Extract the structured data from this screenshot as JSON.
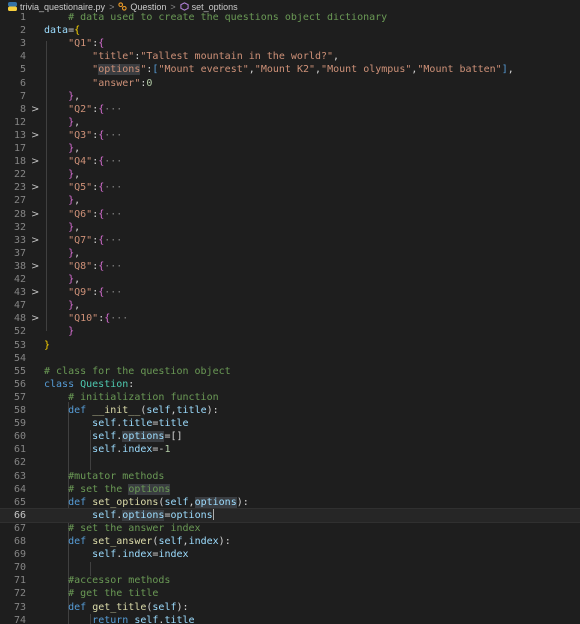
{
  "breadcrumb": {
    "file": "trivia_questionaire.py",
    "class": "Question",
    "method": "set_options"
  },
  "lines": [
    {
      "n": "1",
      "fold": "",
      "tokens": [
        [
          "    ",
          "t-op"
        ],
        [
          "# data used to create the questions object dictionary",
          "t-com"
        ]
      ]
    },
    {
      "n": "2",
      "fold": "",
      "tokens": [
        [
          "data",
          "t-var"
        ],
        [
          "=",
          "t-op"
        ],
        [
          "{",
          "t-brk"
        ]
      ]
    },
    {
      "n": "3",
      "fold": "",
      "tokens": [
        [
          "    ",
          "t-op"
        ],
        [
          "\"Q1\"",
          "t-str"
        ],
        [
          ":",
          "t-op"
        ],
        [
          "{",
          "t-brk2"
        ]
      ]
    },
    {
      "n": "4",
      "fold": "",
      "tokens": [
        [
          "        ",
          "t-op"
        ],
        [
          "\"title\"",
          "t-str"
        ],
        [
          ":",
          "t-op"
        ],
        [
          "\"Tallest mountain in the world?\"",
          "t-str"
        ],
        [
          ",",
          "t-op"
        ]
      ]
    },
    {
      "n": "5",
      "fold": "",
      "tokens": [
        [
          "        ",
          "t-op"
        ],
        [
          "\"",
          "t-str"
        ],
        [
          "options",
          "t-str hl"
        ],
        [
          "\"",
          "t-str"
        ],
        [
          ":",
          "t-op"
        ],
        [
          "[",
          "t-kw"
        ],
        [
          "\"Mount everest\"",
          "t-str"
        ],
        [
          ",",
          "t-op"
        ],
        [
          "\"Mount K2\"",
          "t-str"
        ],
        [
          ",",
          "t-op"
        ],
        [
          "\"Mount olympus\"",
          "t-str"
        ],
        [
          ",",
          "t-op"
        ],
        [
          "\"Mount batten\"",
          "t-str"
        ],
        [
          "]",
          "t-kw"
        ],
        [
          ",",
          "t-op"
        ]
      ]
    },
    {
      "n": "6",
      "fold": "",
      "tokens": [
        [
          "        ",
          "t-op"
        ],
        [
          "\"answer\"",
          "t-str"
        ],
        [
          ":",
          "t-op"
        ],
        [
          "0",
          "t-num"
        ]
      ]
    },
    {
      "n": "7",
      "fold": "",
      "tokens": [
        [
          "    ",
          "t-op"
        ],
        [
          "}",
          "t-brk2"
        ],
        [
          ",",
          "t-op"
        ]
      ]
    },
    {
      "n": "8",
      "fold": ">",
      "tokens": [
        [
          "    ",
          "t-op"
        ],
        [
          "\"Q2\"",
          "t-str"
        ],
        [
          ":",
          "t-op"
        ],
        [
          "{",
          "t-brk2"
        ],
        [
          "···",
          "t-ell"
        ]
      ]
    },
    {
      "n": "12",
      "fold": "",
      "tokens": [
        [
          "    ",
          "t-op"
        ],
        [
          "}",
          "t-brk2"
        ],
        [
          ",",
          "t-op"
        ]
      ]
    },
    {
      "n": "13",
      "fold": ">",
      "tokens": [
        [
          "    ",
          "t-op"
        ],
        [
          "\"Q3\"",
          "t-str"
        ],
        [
          ":",
          "t-op"
        ],
        [
          "{",
          "t-brk2"
        ],
        [
          "···",
          "t-ell"
        ]
      ]
    },
    {
      "n": "17",
      "fold": "",
      "tokens": [
        [
          "    ",
          "t-op"
        ],
        [
          "}",
          "t-brk2"
        ],
        [
          ",",
          "t-op"
        ]
      ]
    },
    {
      "n": "18",
      "fold": ">",
      "tokens": [
        [
          "    ",
          "t-op"
        ],
        [
          "\"Q4\"",
          "t-str"
        ],
        [
          ":",
          "t-op"
        ],
        [
          "{",
          "t-brk2"
        ],
        [
          "···",
          "t-ell"
        ]
      ]
    },
    {
      "n": "22",
      "fold": "",
      "tokens": [
        [
          "    ",
          "t-op"
        ],
        [
          "}",
          "t-brk2"
        ],
        [
          ",",
          "t-op"
        ]
      ]
    },
    {
      "n": "23",
      "fold": ">",
      "tokens": [
        [
          "    ",
          "t-op"
        ],
        [
          "\"Q5\"",
          "t-str"
        ],
        [
          ":",
          "t-op"
        ],
        [
          "{",
          "t-brk2"
        ],
        [
          "···",
          "t-ell"
        ]
      ]
    },
    {
      "n": "27",
      "fold": "",
      "tokens": [
        [
          "    ",
          "t-op"
        ],
        [
          "}",
          "t-brk2"
        ],
        [
          ",",
          "t-op"
        ]
      ]
    },
    {
      "n": "28",
      "fold": ">",
      "tokens": [
        [
          "    ",
          "t-op"
        ],
        [
          "\"Q6\"",
          "t-str"
        ],
        [
          ":",
          "t-op"
        ],
        [
          "{",
          "t-brk2"
        ],
        [
          "···",
          "t-ell"
        ]
      ]
    },
    {
      "n": "32",
      "fold": "",
      "tokens": [
        [
          "    ",
          "t-op"
        ],
        [
          "}",
          "t-brk2"
        ],
        [
          ",",
          "t-op"
        ]
      ]
    },
    {
      "n": "33",
      "fold": ">",
      "tokens": [
        [
          "    ",
          "t-op"
        ],
        [
          "\"Q7\"",
          "t-str"
        ],
        [
          ":",
          "t-op"
        ],
        [
          "{",
          "t-brk2"
        ],
        [
          "···",
          "t-ell"
        ]
      ]
    },
    {
      "n": "37",
      "fold": "",
      "tokens": [
        [
          "    ",
          "t-op"
        ],
        [
          "}",
          "t-brk2"
        ],
        [
          ",",
          "t-op"
        ]
      ]
    },
    {
      "n": "38",
      "fold": ">",
      "tokens": [
        [
          "    ",
          "t-op"
        ],
        [
          "\"Q8\"",
          "t-str"
        ],
        [
          ":",
          "t-op"
        ],
        [
          "{",
          "t-brk2"
        ],
        [
          "···",
          "t-ell"
        ]
      ]
    },
    {
      "n": "42",
      "fold": "",
      "tokens": [
        [
          "    ",
          "t-op"
        ],
        [
          "}",
          "t-brk2"
        ],
        [
          ",",
          "t-op"
        ]
      ]
    },
    {
      "n": "43",
      "fold": ">",
      "tokens": [
        [
          "    ",
          "t-op"
        ],
        [
          "\"Q9\"",
          "t-str"
        ],
        [
          ":",
          "t-op"
        ],
        [
          "{",
          "t-brk2"
        ],
        [
          "···",
          "t-ell"
        ]
      ]
    },
    {
      "n": "47",
      "fold": "",
      "tokens": [
        [
          "    ",
          "t-op"
        ],
        [
          "}",
          "t-brk2"
        ],
        [
          ",",
          "t-op"
        ]
      ]
    },
    {
      "n": "48",
      "fold": ">",
      "tokens": [
        [
          "    ",
          "t-op"
        ],
        [
          "\"Q10\"",
          "t-str"
        ],
        [
          ":",
          "t-op"
        ],
        [
          "{",
          "t-brk2"
        ],
        [
          "···",
          "t-ell"
        ]
      ]
    },
    {
      "n": "52",
      "fold": "",
      "tokens": [
        [
          "    ",
          "t-op"
        ],
        [
          "}",
          "t-brk2"
        ]
      ]
    },
    {
      "n": "53",
      "fold": "",
      "tokens": [
        [
          "}",
          "t-brk"
        ]
      ]
    },
    {
      "n": "54",
      "fold": "",
      "tokens": []
    },
    {
      "n": "55",
      "fold": "",
      "tokens": [
        [
          "# class for the question object",
          "t-com"
        ]
      ]
    },
    {
      "n": "56",
      "fold": "",
      "tokens": [
        [
          "class ",
          "t-kw"
        ],
        [
          "Question",
          "t-cls"
        ],
        [
          ":",
          "t-op"
        ]
      ]
    },
    {
      "n": "57",
      "fold": "",
      "tokens": [
        [
          "    ",
          "t-op"
        ],
        [
          "# initialization function",
          "t-com"
        ]
      ]
    },
    {
      "n": "58",
      "fold": "",
      "tokens": [
        [
          "    ",
          "t-op"
        ],
        [
          "def ",
          "t-kw"
        ],
        [
          "__init__",
          "t-fn"
        ],
        [
          "(",
          "t-op"
        ],
        [
          "self",
          "t-self"
        ],
        [
          ",",
          "t-op"
        ],
        [
          "title",
          "t-self"
        ],
        [
          "):",
          "t-op"
        ]
      ]
    },
    {
      "n": "59",
      "fold": "",
      "tokens": [
        [
          "        ",
          "t-op"
        ],
        [
          "self",
          "t-self"
        ],
        [
          ".",
          "t-op"
        ],
        [
          "title",
          "t-self"
        ],
        [
          "=",
          "t-op"
        ],
        [
          "title",
          "t-self"
        ]
      ]
    },
    {
      "n": "60",
      "fold": "",
      "tokens": [
        [
          "        ",
          "t-op"
        ],
        [
          "self",
          "t-self"
        ],
        [
          ".",
          "t-op"
        ],
        [
          "options",
          "t-self hl"
        ],
        [
          "=[]",
          "t-op"
        ]
      ]
    },
    {
      "n": "61",
      "fold": "",
      "tokens": [
        [
          "        ",
          "t-op"
        ],
        [
          "self",
          "t-self"
        ],
        [
          ".",
          "t-op"
        ],
        [
          "index",
          "t-self"
        ],
        [
          "=-",
          "t-op"
        ],
        [
          "1",
          "t-num"
        ]
      ]
    },
    {
      "n": "62",
      "fold": "",
      "tokens": []
    },
    {
      "n": "63",
      "fold": "",
      "tokens": [
        [
          "    ",
          "t-op"
        ],
        [
          "#mutator methods",
          "t-com"
        ]
      ]
    },
    {
      "n": "64",
      "fold": "",
      "tokens": [
        [
          "    ",
          "t-op"
        ],
        [
          "# set the ",
          "t-com"
        ],
        [
          "options",
          "t-com hl"
        ]
      ]
    },
    {
      "n": "65",
      "fold": "",
      "tokens": [
        [
          "    ",
          "t-op"
        ],
        [
          "def ",
          "t-kw"
        ],
        [
          "set_options",
          "t-fn"
        ],
        [
          "(",
          "t-op"
        ],
        [
          "self",
          "t-self"
        ],
        [
          ",",
          "t-op"
        ],
        [
          "options",
          "t-self hl"
        ],
        [
          "):",
          "t-op"
        ]
      ]
    },
    {
      "n": "66",
      "fold": "",
      "current": true,
      "tokens": [
        [
          "        ",
          "t-op"
        ],
        [
          "self",
          "t-self"
        ],
        [
          ".",
          "t-op"
        ],
        [
          "options",
          "t-self hl"
        ],
        [
          "=",
          "t-op"
        ],
        [
          "options",
          "t-self"
        ]
      ]
    },
    {
      "n": "67",
      "fold": "",
      "tokens": [
        [
          "    ",
          "t-op"
        ],
        [
          "# set the answer index",
          "t-com"
        ]
      ]
    },
    {
      "n": "68",
      "fold": "",
      "tokens": [
        [
          "    ",
          "t-op"
        ],
        [
          "def ",
          "t-kw"
        ],
        [
          "set_answer",
          "t-fn"
        ],
        [
          "(",
          "t-op"
        ],
        [
          "self",
          "t-self"
        ],
        [
          ",",
          "t-op"
        ],
        [
          "index",
          "t-self"
        ],
        [
          "):",
          "t-op"
        ]
      ]
    },
    {
      "n": "69",
      "fold": "",
      "tokens": [
        [
          "        ",
          "t-op"
        ],
        [
          "self",
          "t-self"
        ],
        [
          ".",
          "t-op"
        ],
        [
          "index",
          "t-self"
        ],
        [
          "=",
          "t-op"
        ],
        [
          "index",
          "t-self"
        ]
      ]
    },
    {
      "n": "70",
      "fold": "",
      "tokens": []
    },
    {
      "n": "71",
      "fold": "",
      "tokens": [
        [
          "    ",
          "t-op"
        ],
        [
          "#accessor methods",
          "t-com"
        ]
      ]
    },
    {
      "n": "72",
      "fold": "",
      "tokens": [
        [
          "    ",
          "t-op"
        ],
        [
          "# get the title",
          "t-com"
        ]
      ]
    },
    {
      "n": "73",
      "fold": "",
      "tokens": [
        [
          "    ",
          "t-op"
        ],
        [
          "def ",
          "t-kw"
        ],
        [
          "get_title",
          "t-fn"
        ],
        [
          "(",
          "t-op"
        ],
        [
          "self",
          "t-self"
        ],
        [
          "):",
          "t-op"
        ]
      ]
    },
    {
      "n": "74",
      "fold": "",
      "tokens": [
        [
          "        ",
          "t-op"
        ],
        [
          "return ",
          "t-kw"
        ],
        [
          "self",
          "t-self"
        ],
        [
          ".",
          "t-op"
        ],
        [
          "title",
          "t-self"
        ]
      ]
    }
  ]
}
